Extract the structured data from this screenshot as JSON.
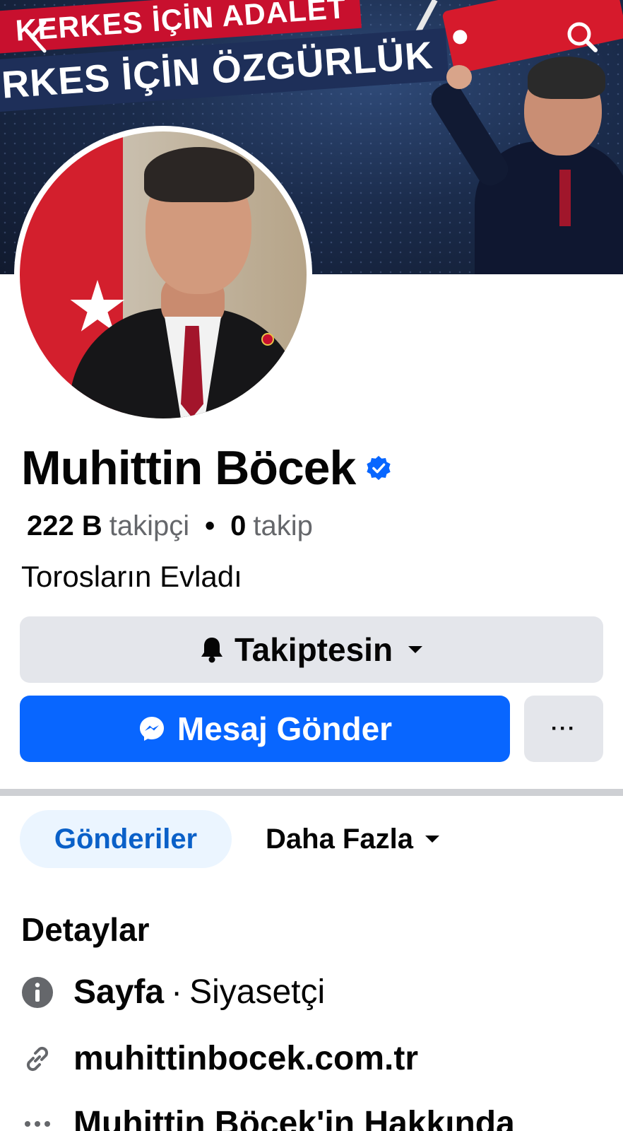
{
  "cover": {
    "banner_line1": "KERKES İÇİN ADALET",
    "banner_line2": "RKES İÇİN ÖZGÜRLÜK"
  },
  "nav": {
    "back_icon": "chevron-left-icon",
    "search_icon": "search-icon"
  },
  "profile": {
    "name": "Muhittin Böcek",
    "verified": true,
    "followers_count": "222 B",
    "followers_label": "takipçi",
    "separator": "•",
    "following_count": "0",
    "following_label": "takip",
    "bio": "Torosların Evladı"
  },
  "actions": {
    "follow_label": "Takiptesin",
    "message_label": "Mesaj Gönder",
    "more_label": "···"
  },
  "tabs": [
    {
      "label": "Gönderiler",
      "active": true
    },
    {
      "label": "Daha Fazla",
      "active": false
    }
  ],
  "details": {
    "title": "Detaylar",
    "page_type_bold": "Sayfa",
    "page_type_sep": "·",
    "page_category": "Siyasetçi",
    "website": "muhittinbocek.com.tr",
    "about": "Muhittin Böcek'in Hakkında"
  },
  "colors": {
    "accent": "#0866ff",
    "tab_active_bg": "#ebf5ff",
    "tab_active_text": "#0a60c8",
    "button_gray": "#e4e6eb",
    "muted_text": "#65676b"
  }
}
